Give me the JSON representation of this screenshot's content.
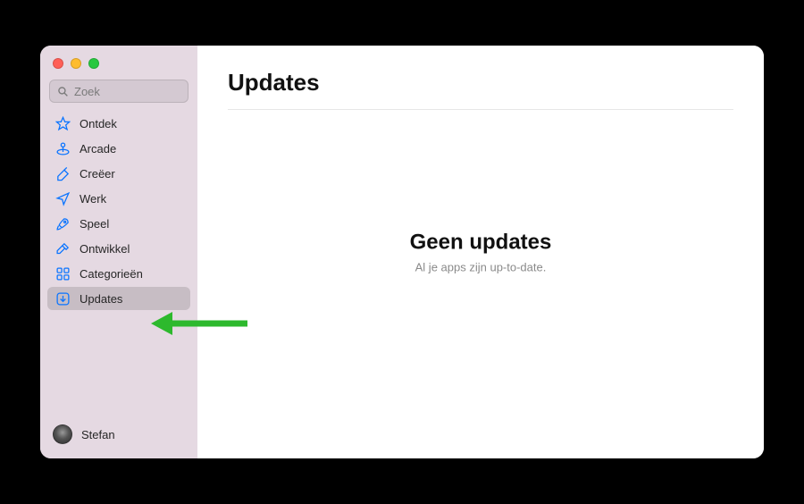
{
  "search": {
    "placeholder": "Zoek"
  },
  "sidebar": {
    "items": [
      {
        "label": "Ontdek",
        "icon": "star-icon"
      },
      {
        "label": "Arcade",
        "icon": "arcade-icon"
      },
      {
        "label": "Creëer",
        "icon": "brush-icon"
      },
      {
        "label": "Werk",
        "icon": "paperplane-icon"
      },
      {
        "label": "Speel",
        "icon": "rocket-icon"
      },
      {
        "label": "Ontwikkel",
        "icon": "hammer-icon"
      },
      {
        "label": "Categorieën",
        "icon": "grid-icon"
      },
      {
        "label": "Updates",
        "icon": "download-box-icon"
      }
    ],
    "selected_index": 7
  },
  "user": {
    "name": "Stefan"
  },
  "main": {
    "title": "Updates",
    "empty_title": "Geen updates",
    "empty_subtitle": "Al je apps zijn up-to-date."
  },
  "colors": {
    "accent": "#0a74ff",
    "sidebar_bg": "#e5d9e2",
    "arrow": "#2db92d"
  }
}
